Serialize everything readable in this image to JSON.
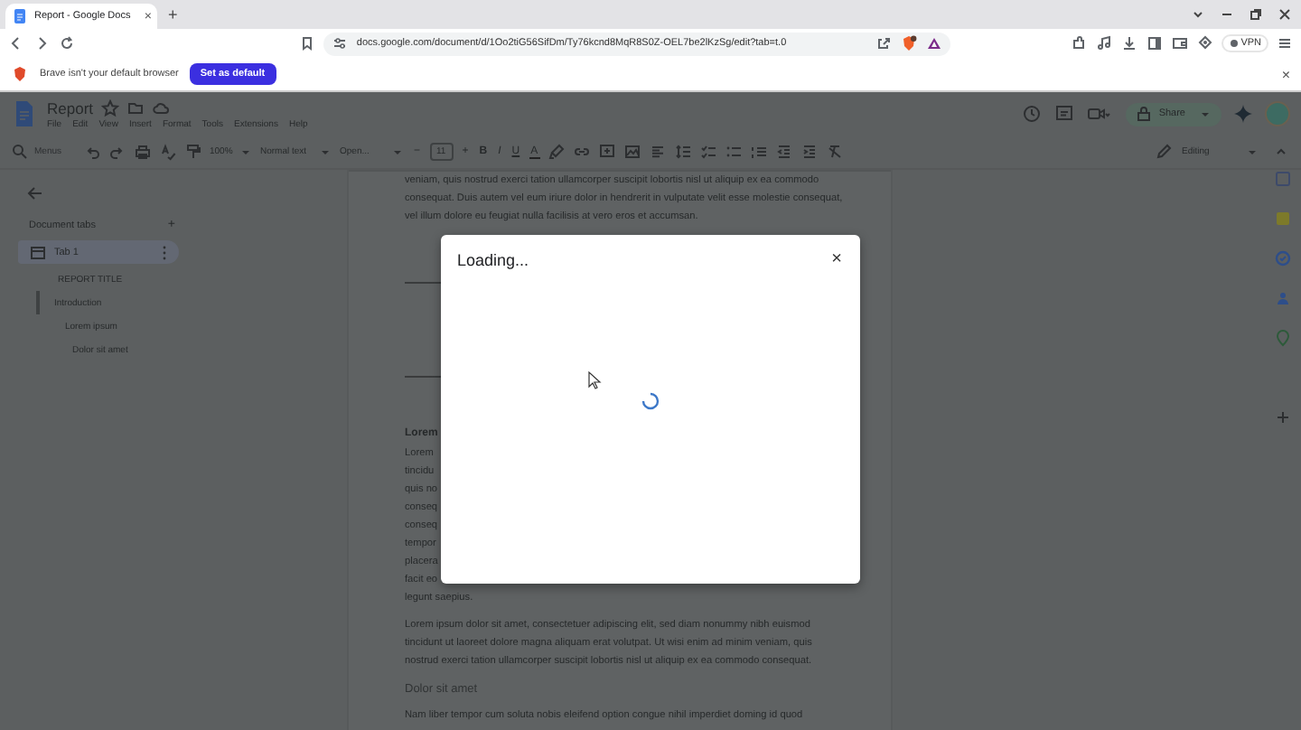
{
  "browser": {
    "tabs": [
      {
        "title": "Report - Google Docs",
        "selected": true,
        "close": "×"
      }
    ],
    "new_tab": "+",
    "url": "docs.google.com/document/d/1Oo2tiG56SifDm/Ty76kcnd8MqR8S0Z-OEL7be2lKzSg/edit?tab=t.0",
    "vpn": "VPN",
    "infobar": {
      "message": "Brave isn't your default browser",
      "button": "Set as default",
      "close": "×"
    }
  },
  "docs": {
    "title": "Report",
    "menus": [
      "File",
      "Edit",
      "View",
      "Insert",
      "Format",
      "Tools",
      "Extensions",
      "Help"
    ],
    "share": "Share",
    "toolbar": {
      "search": "Menus",
      "zoom": "100%",
      "style": "Normal text",
      "font": "Open...",
      "minus": "−",
      "size": "11",
      "plus": "+",
      "format": [
        "B",
        "I",
        "U",
        "A"
      ],
      "mode": "Editing"
    },
    "outline": {
      "heading": "Document tabs",
      "add": "+",
      "tabs": [
        {
          "label": "Tab 1",
          "selected": true,
          "children": [
            {
              "label": "REPORT TITLE",
              "selected": false
            },
            {
              "label": "Introduction",
              "selected": true,
              "children": [
                {
                  "label": "Lorem ipsum",
                  "selected": false,
                  "children": [
                    {
                      "label": "Dolor sit amet",
                      "selected": false
                    }
                  ]
                }
              ]
            }
          ]
        }
      ]
    },
    "document": {
      "blocks": [
        {
          "kind": "paragraph",
          "text": "veniam, quis nostrud exerci tation ullamcorper suscipit lobortis nisl ut aliquip ex ea commodo consequat. Duis autem vel eum iriure dolor in hendrerit in vulputate velit esse molestie consequat, vel illum dolore eu feugiat nulla facilisis at vero eros et accumsan."
        },
        {
          "kind": "break"
        },
        {
          "kind": "heading",
          "text": "Lorem"
        },
        {
          "kind": "covered",
          "lines": [
            "Lorem",
            "tincidu",
            "quis no",
            "conseq",
            "conseq",
            "tempor",
            "placera",
            "facit eo",
            "legunt saepius."
          ]
        },
        {
          "kind": "paragraph",
          "text": "Lorem ipsum dolor sit amet, consectetuer adipiscing elit, sed diam nonummy nibh euismod tincidunt ut laoreet dolore magna aliquam erat volutpat. Ut wisi enim ad minim veniam, quis nostrud exerci tation ullamcorper suscipit lobortis nisl ut aliquip ex ea commodo consequat."
        },
        {
          "kind": "subheading",
          "text": "Dolor sit amet"
        },
        {
          "kind": "paragraph",
          "text": "Nam liber tempor cum soluta nobis eleifend option congue nihil imperdiet doming id quod"
        }
      ]
    }
  },
  "dialog": {
    "title": "Loading...",
    "close": "×"
  }
}
